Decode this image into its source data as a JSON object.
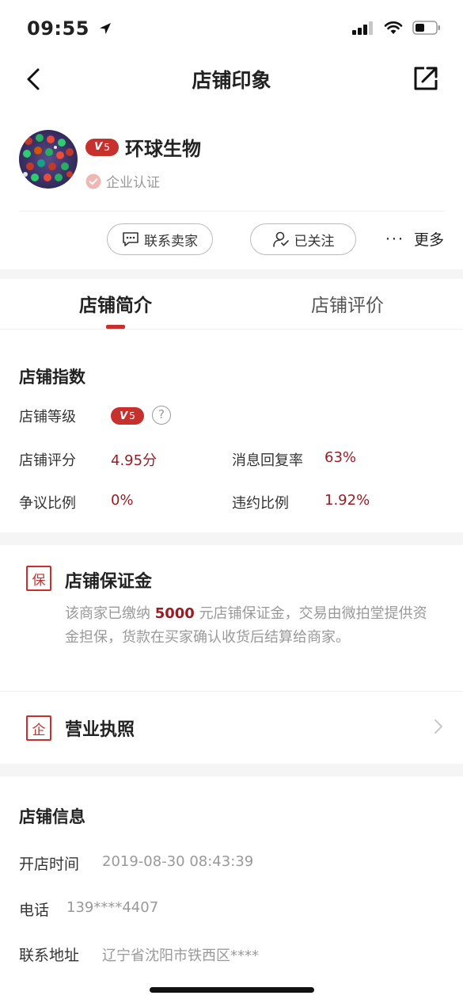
{
  "status_bar": {
    "time": "09:55"
  },
  "nav": {
    "title": "店铺印象"
  },
  "shop": {
    "level_badge_letter": "V",
    "level_badge_number": "5",
    "name": "环球生物",
    "verification": "企业认证"
  },
  "actions": {
    "contact_seller": "联系卖家",
    "following": "已关注",
    "more_dots": "···",
    "more": "更多"
  },
  "tabs": {
    "intro": "店铺简介",
    "reviews": "店铺评价"
  },
  "shop_index": {
    "title": "店铺指数",
    "level_label": "店铺等级",
    "level_help_mark": "?",
    "rating_label": "店铺评分",
    "rating_value": "4.95分",
    "reply_rate_label": "消息回复率",
    "reply_rate_value": "63%",
    "dispute_label": "争议比例",
    "dispute_value": "0%",
    "breach_label": "违约比例",
    "breach_value": "1.92%"
  },
  "deposit": {
    "icon_char": "保",
    "title": "店铺保证金",
    "desc_before": "该商家已缴纳 ",
    "amount": "5000",
    "desc_after": " 元店铺保证金，交易由微拍堂提供资金担保，货款在买家确认收货后结算给商家。"
  },
  "license": {
    "icon_char": "企",
    "title": "营业执照"
  },
  "shop_info": {
    "title": "店铺信息",
    "open_time_label": "开店时间",
    "open_time_value": "2019-08-30 08:43:39",
    "phone_label": "电话",
    "phone_value": "139****4407",
    "address_label": "联系地址",
    "address_value": "辽宁省沈阳市铁西区****"
  },
  "colors": {
    "accent": "#c8302e",
    "value_red": "#9a1d24",
    "muted": "#999999",
    "band": "#f5f5f5"
  }
}
